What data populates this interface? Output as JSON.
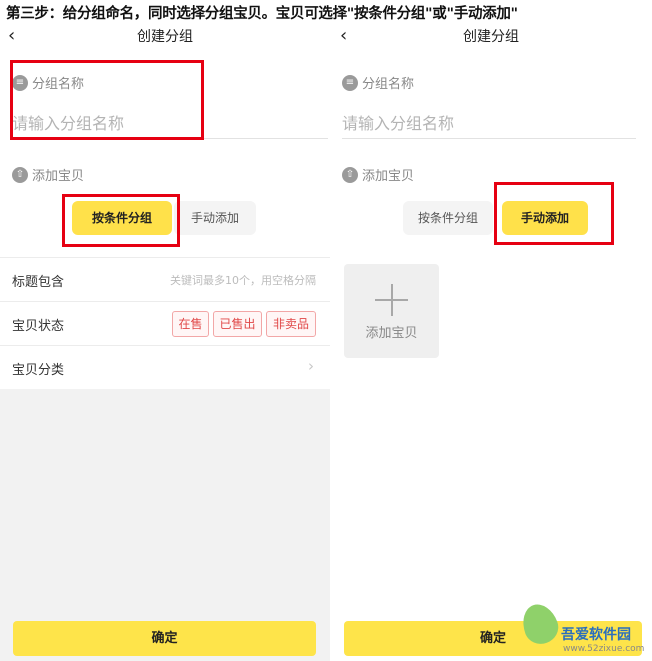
{
  "caption": "第三步：给分组命名，同时选择分组宝贝。宝贝可选择\"按条件分组\"或\"手动添加\"",
  "left": {
    "nav": {
      "back_icon": "‹",
      "title": "创建分组"
    },
    "group_name_label": "分组名称",
    "group_name_placeholder": "请输入分组名称",
    "add_items_label": "添加宝贝",
    "tabs": {
      "by_condition": "按条件分组",
      "manual": "手动添加",
      "selected": "按条件分组"
    },
    "filters": {
      "title_contains": {
        "label": "标题包含",
        "placeholder": "关键词最多10个，用空格分隔"
      },
      "item_status": {
        "label": "宝贝状态",
        "options": [
          "在售",
          "已售出",
          "非卖品"
        ]
      },
      "item_category": {
        "label": "宝贝分类"
      }
    },
    "confirm": "确定"
  },
  "right": {
    "nav": {
      "back_icon": "‹",
      "title": "创建分组"
    },
    "group_name_label": "分组名称",
    "group_name_placeholder": "请输入分组名称",
    "add_items_label": "添加宝贝",
    "tabs": {
      "by_condition": "按条件分组",
      "manual": "手动添加",
      "selected": "手动添加"
    },
    "add_card_label": "添加宝贝",
    "confirm": "确定"
  },
  "watermark": {
    "name": "吾爱软件园",
    "url": "www.52zixue.com"
  },
  "colors": {
    "accent_yellow": "#fee44a",
    "highlight_red": "#e60012",
    "tag_red": "#e04848",
    "panel_bg": "#f2f2f2"
  }
}
